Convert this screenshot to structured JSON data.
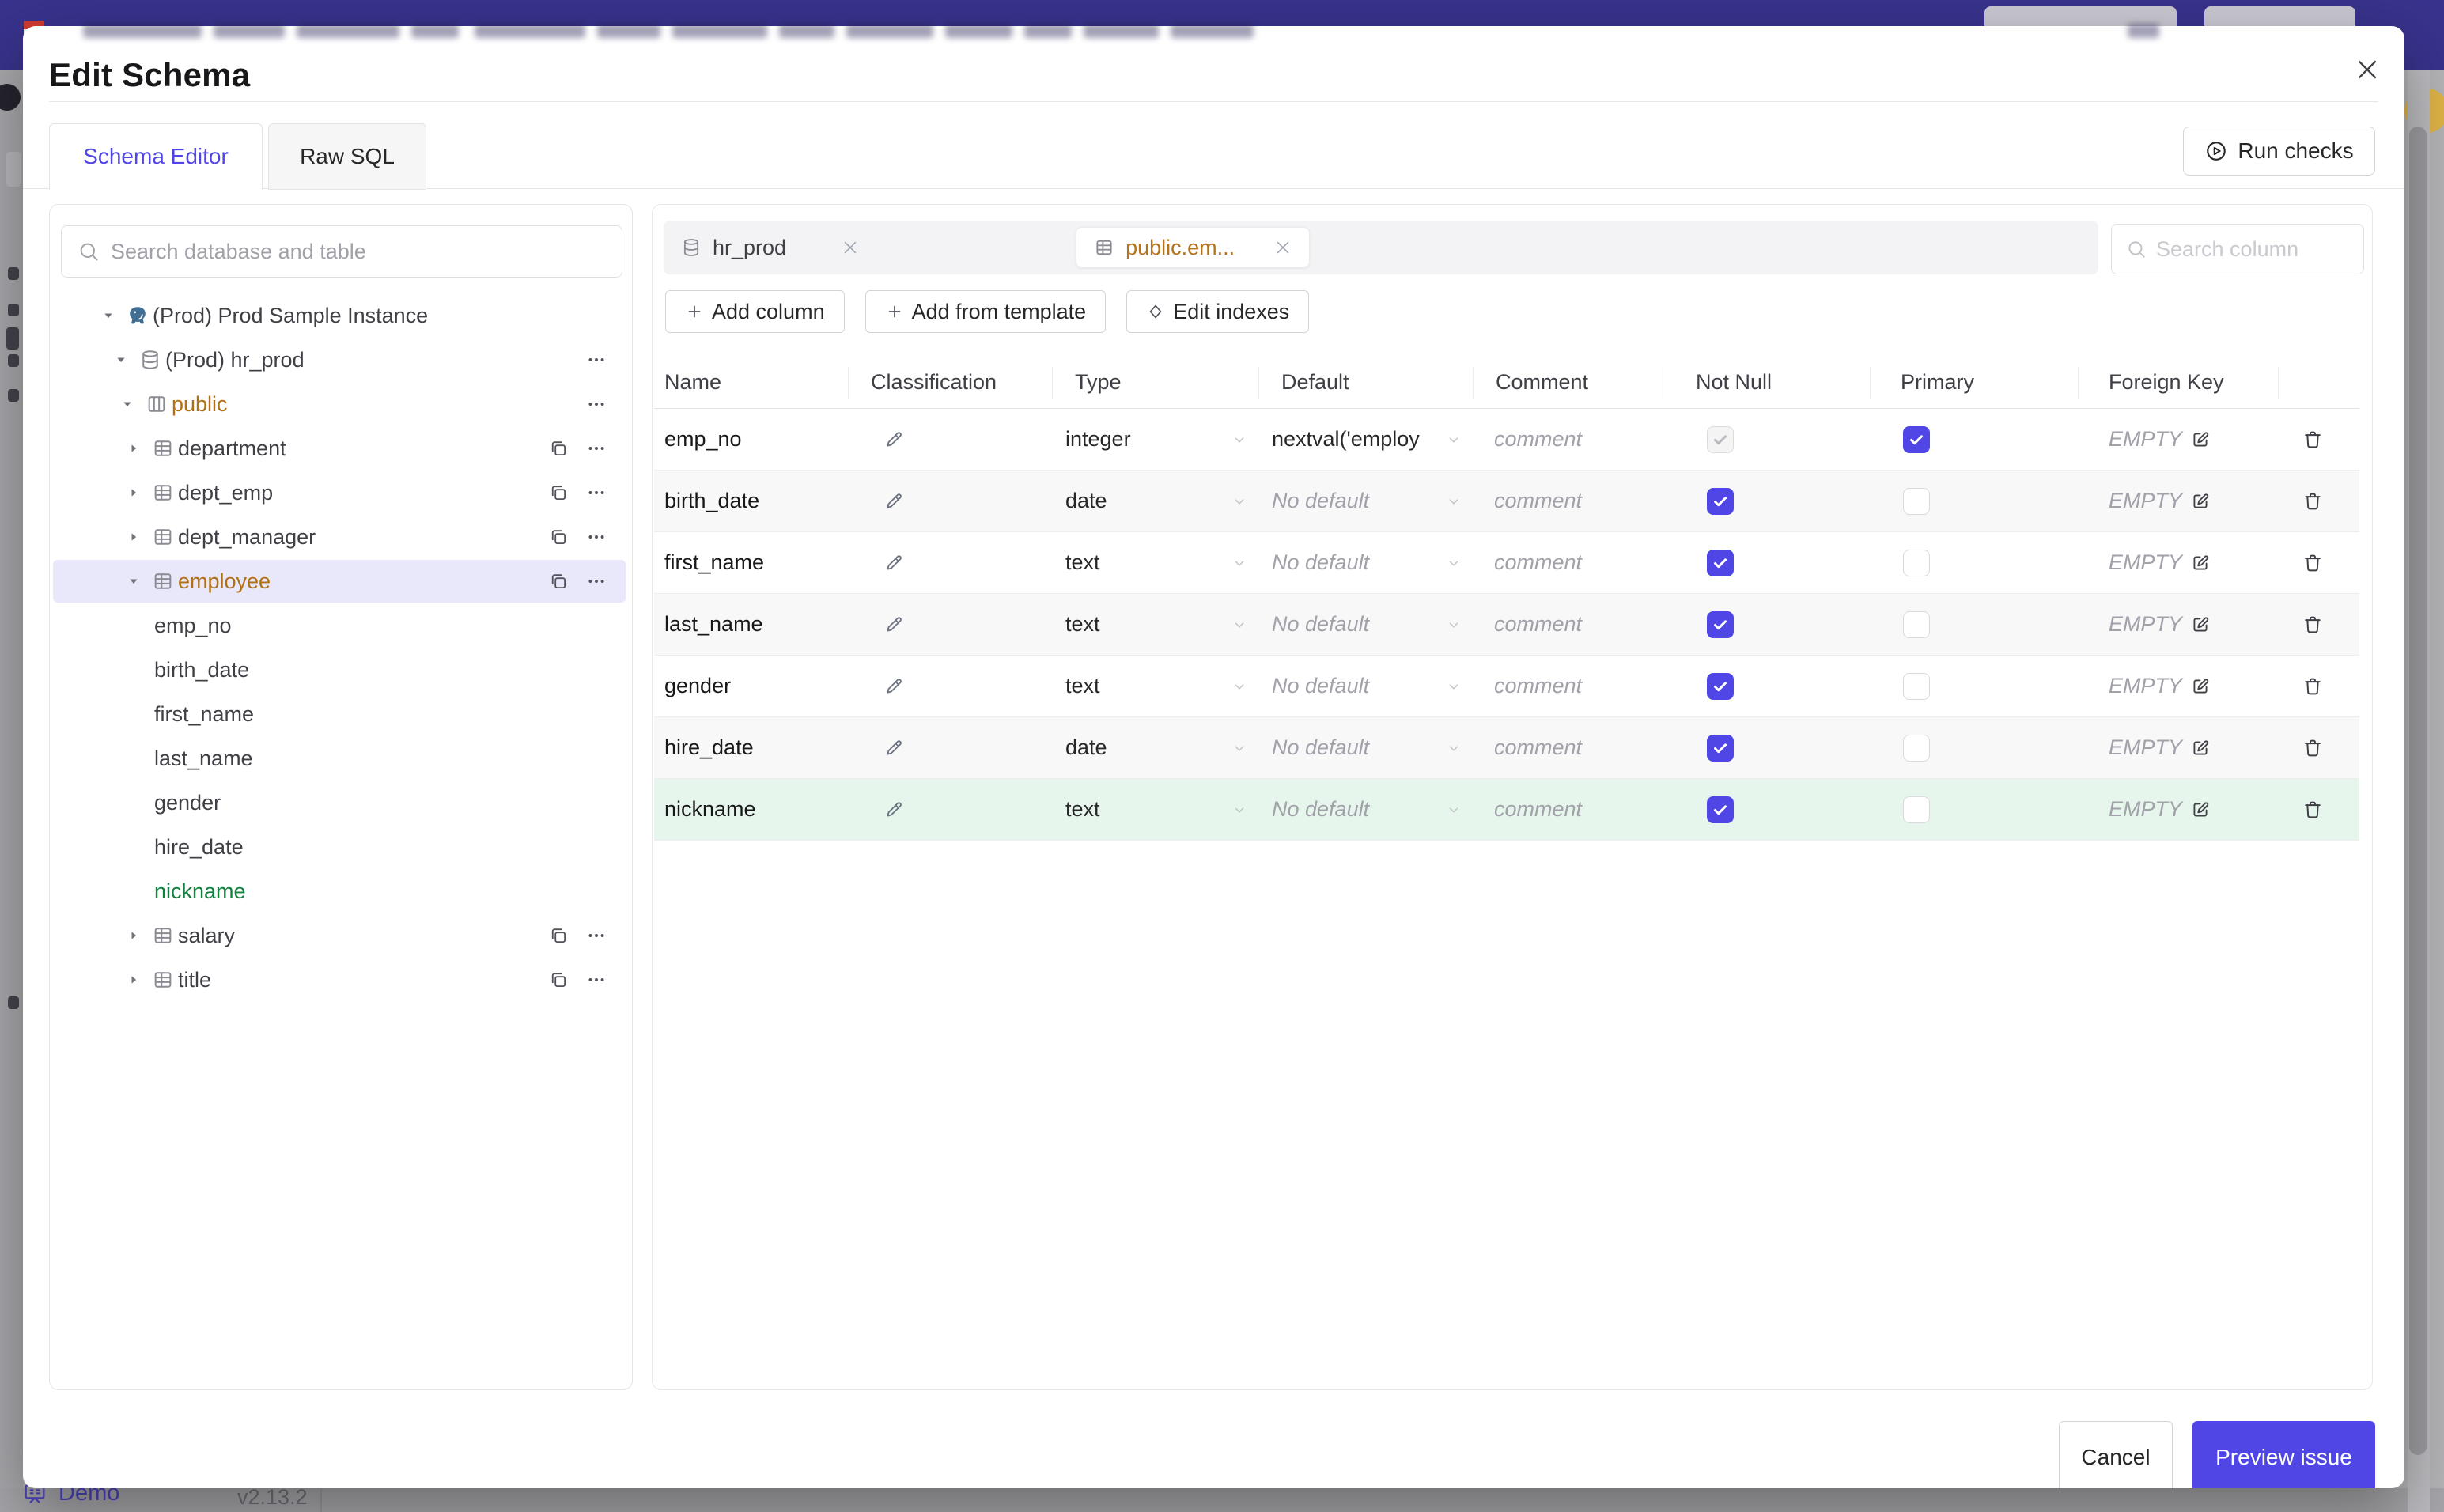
{
  "modal": {
    "title": "Edit Schema",
    "view_tabs": [
      {
        "label": "Schema Editor",
        "active": true
      },
      {
        "label": "Raw SQL",
        "active": false
      }
    ],
    "run_checks": {
      "label": "Run checks",
      "icon": "play-circle-icon"
    },
    "sidebar": {
      "search": {
        "placeholder": "Search database and table",
        "icon": "search-icon"
      },
      "tree": [
        {
          "label": "(Prod) Prod Sample Instance",
          "icon": "postgresql-icon",
          "caret": "expanded",
          "level": 0,
          "color": "default",
          "selected": false,
          "actions": []
        },
        {
          "label": "(Prod) hr_prod",
          "icon": "database-icon",
          "caret": "expanded",
          "level": 1,
          "color": "default",
          "selected": false,
          "actions": [
            "more"
          ]
        },
        {
          "label": "public",
          "icon": "schema-icon",
          "caret": "expanded",
          "level": 2,
          "color": "amber",
          "selected": false,
          "actions": [
            "more"
          ]
        },
        {
          "label": "department",
          "icon": "table-icon",
          "caret": "collapsed",
          "level": 3,
          "color": "default",
          "selected": false,
          "actions": [
            "copy",
            "more"
          ]
        },
        {
          "label": "dept_emp",
          "icon": "table-icon",
          "caret": "collapsed",
          "level": 3,
          "color": "default",
          "selected": false,
          "actions": [
            "copy",
            "more"
          ]
        },
        {
          "label": "dept_manager",
          "icon": "table-icon",
          "caret": "collapsed",
          "level": 3,
          "color": "default",
          "selected": false,
          "actions": [
            "copy",
            "more"
          ]
        },
        {
          "label": "employee",
          "icon": "table-icon",
          "caret": "expanded",
          "level": 3,
          "color": "amber",
          "selected": true,
          "actions": [
            "copy",
            "more"
          ]
        },
        {
          "label": "emp_no",
          "icon": null,
          "caret": "none",
          "level": 4,
          "color": "default",
          "selected": false,
          "actions": []
        },
        {
          "label": "birth_date",
          "icon": null,
          "caret": "none",
          "level": 4,
          "color": "default",
          "selected": false,
          "actions": []
        },
        {
          "label": "first_name",
          "icon": null,
          "caret": "none",
          "level": 4,
          "color": "default",
          "selected": false,
          "actions": []
        },
        {
          "label": "last_name",
          "icon": null,
          "caret": "none",
          "level": 4,
          "color": "default",
          "selected": false,
          "actions": []
        },
        {
          "label": "gender",
          "icon": null,
          "caret": "none",
          "level": 4,
          "color": "default",
          "selected": false,
          "actions": []
        },
        {
          "label": "hire_date",
          "icon": null,
          "caret": "none",
          "level": 4,
          "color": "default",
          "selected": false,
          "actions": []
        },
        {
          "label": "nickname",
          "icon": null,
          "caret": "none",
          "level": 4,
          "color": "green",
          "selected": false,
          "actions": []
        },
        {
          "label": "salary",
          "icon": "table-icon",
          "caret": "collapsed",
          "level": 3,
          "color": "default",
          "selected": false,
          "actions": [
            "copy",
            "more"
          ]
        },
        {
          "label": "title",
          "icon": "table-icon",
          "caret": "collapsed",
          "level": 3,
          "color": "default",
          "selected": false,
          "actions": [
            "copy",
            "more"
          ]
        }
      ]
    },
    "editor": {
      "open_tabs": [
        {
          "label": "hr_prod",
          "icon": "database-icon",
          "active": false
        },
        {
          "label": "public.em...",
          "icon": "table-icon",
          "active": true
        }
      ],
      "column_search": {
        "placeholder": "Search column",
        "icon": "search-icon"
      },
      "toolbar": [
        {
          "label": "Add column",
          "icon": "plus-icon"
        },
        {
          "label": "Add from template",
          "icon": "plus-icon"
        },
        {
          "label": "Edit indexes",
          "icon": "diamond-icon"
        }
      ],
      "table": {
        "headers": [
          "Name",
          "Classification",
          "Type",
          "Default",
          "Comment",
          "Not Null",
          "Primary",
          "Foreign Key"
        ],
        "comment_placeholder": "comment",
        "foreign_key_placeholder": "EMPTY",
        "no_default_placeholder": "No default",
        "rows": [
          {
            "name": "emp_no",
            "type": "integer",
            "default": "nextval('employ",
            "has_default": true,
            "not_null": "checked-disabled",
            "primary": "checked",
            "highlight": false
          },
          {
            "name": "birth_date",
            "type": "date",
            "default": "",
            "has_default": false,
            "not_null": "checked",
            "primary": "unchecked",
            "highlight": false
          },
          {
            "name": "first_name",
            "type": "text",
            "default": "",
            "has_default": false,
            "not_null": "checked",
            "primary": "unchecked",
            "highlight": false
          },
          {
            "name": "last_name",
            "type": "text",
            "default": "",
            "has_default": false,
            "not_null": "checked",
            "primary": "unchecked",
            "highlight": false
          },
          {
            "name": "gender",
            "type": "text",
            "default": "",
            "has_default": false,
            "not_null": "checked",
            "primary": "unchecked",
            "highlight": false
          },
          {
            "name": "hire_date",
            "type": "date",
            "default": "",
            "has_default": false,
            "not_null": "checked",
            "primary": "unchecked",
            "highlight": false
          },
          {
            "name": "nickname",
            "type": "text",
            "default": "",
            "has_default": false,
            "not_null": "checked",
            "primary": "unchecked",
            "highlight": true
          }
        ]
      }
    },
    "footer": {
      "cancel_label": "Cancel",
      "submit_label": "Preview issue"
    }
  },
  "statusbar": {
    "demo_label": "Demo",
    "version": "v2.13.2"
  },
  "colors": {
    "accent": "#4f46e5",
    "banner": "#38338c",
    "amber": "#b07116",
    "green": "#12813e",
    "highlight_row": "#e7f6ec",
    "selected_tree_row": "#e9e8fa",
    "avatar": "#dfb347"
  }
}
